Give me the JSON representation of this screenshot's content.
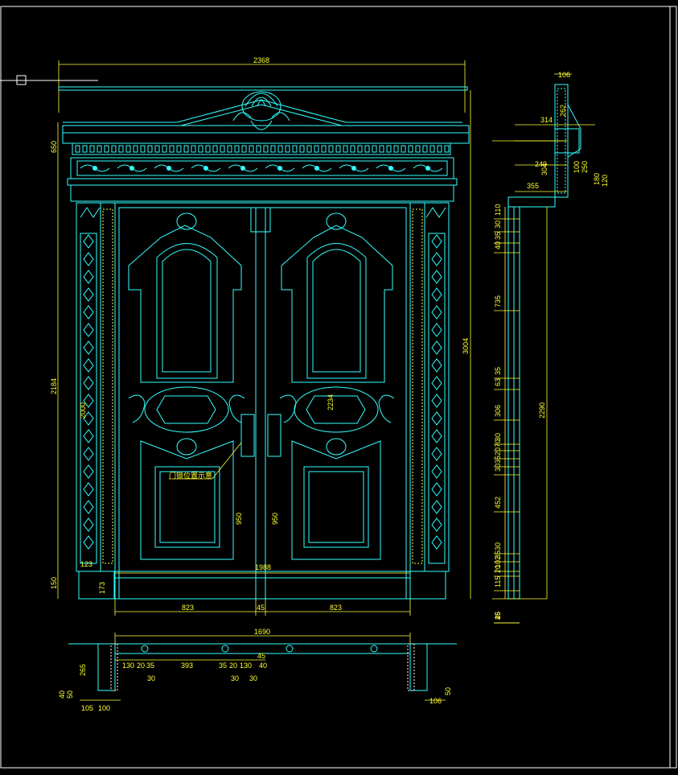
{
  "app": {
    "title": "",
    "background": "#000000",
    "line_color_primary": "#33ffff",
    "line_color_dims": "#ffff33",
    "frame_color": "#ffffff"
  },
  "drawing": {
    "overall": {
      "total_width": "2368",
      "total_height": "3004",
      "cornice_height": "650",
      "side_height": "2184",
      "base_height": "150",
      "pilaster_height": "2000",
      "plinth_dim": "173",
      "pilaster_base": "123",
      "door_opening": "1988",
      "leaf_height": "2234"
    },
    "door": {
      "leaf_left": "823",
      "gap": "45",
      "leaf_right": "823",
      "handle_left": "950",
      "handle_right": "950",
      "note": "门锁位置示意"
    },
    "section_right": {
      "top_width": "106",
      "dims": [
        "314",
        "249",
        "304",
        "355",
        "262",
        "100",
        "250",
        "180",
        "120"
      ],
      "total": "2290",
      "vertical": [
        "110",
        "30",
        "35",
        "40",
        "735",
        "35",
        "63",
        "306",
        "30",
        "70",
        "20",
        "35",
        "30",
        "452",
        "30",
        "35",
        "102",
        "20",
        "115",
        "25",
        "25",
        "46"
      ]
    },
    "plan_bottom": {
      "total": "1690",
      "dims": [
        "265",
        "130",
        "20",
        "35",
        "393",
        "35",
        "20",
        "130",
        "40",
        "30",
        "30",
        "45",
        "30"
      ],
      "small": [
        "40",
        "50",
        "105",
        "100",
        "106",
        "50"
      ]
    },
    "command_cursor": "□"
  }
}
